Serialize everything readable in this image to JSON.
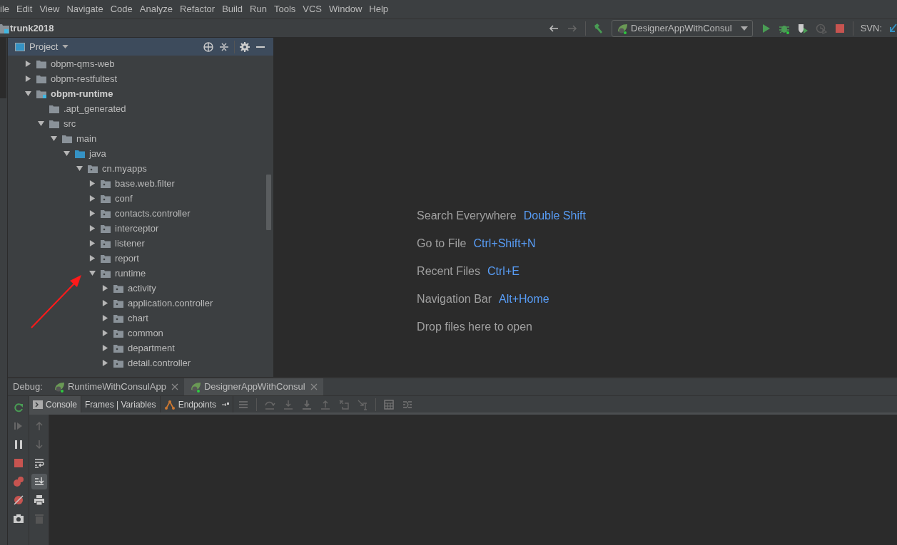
{
  "menu": [
    "ile",
    "Edit",
    "View",
    "Navigate",
    "Code",
    "Analyze",
    "Refactor",
    "Build",
    "Run",
    "Tools",
    "VCS",
    "Window",
    "Help"
  ],
  "nav": {
    "project": "trunk2018",
    "run_config": "DesignerAppWithConsul",
    "svn_label": "SVN:"
  },
  "project_panel": {
    "title": "Project",
    "tree": [
      {
        "label": "obpm-qms-web",
        "kind": "folder",
        "expanded": false
      },
      {
        "label": "obpm-restfultest",
        "kind": "folder",
        "expanded": false
      },
      {
        "label": "obpm-runtime",
        "kind": "module",
        "expanded": true,
        "children": [
          {
            "label": ".apt_generated",
            "kind": "folder"
          },
          {
            "label": "src",
            "kind": "folder",
            "expanded": true,
            "children": [
              {
                "label": "main",
                "kind": "folder",
                "expanded": true,
                "children": [
                  {
                    "label": "java",
                    "kind": "source",
                    "expanded": true,
                    "children": [
                      {
                        "label": "cn.myapps",
                        "kind": "package",
                        "expanded": true,
                        "children": [
                          {
                            "label": "base.web.filter",
                            "kind": "package",
                            "expanded": false
                          },
                          {
                            "label": "conf",
                            "kind": "package",
                            "expanded": false
                          },
                          {
                            "label": "contacts.controller",
                            "kind": "package",
                            "expanded": false
                          },
                          {
                            "label": "interceptor",
                            "kind": "package",
                            "expanded": false
                          },
                          {
                            "label": "listener",
                            "kind": "package",
                            "expanded": false
                          },
                          {
                            "label": "report",
                            "kind": "package",
                            "expanded": false
                          },
                          {
                            "label": "runtime",
                            "kind": "package",
                            "expanded": true,
                            "children": [
                              {
                                "label": "activity",
                                "kind": "package",
                                "expanded": false
                              },
                              {
                                "label": "application.controller",
                                "kind": "package",
                                "expanded": false
                              },
                              {
                                "label": "chart",
                                "kind": "package",
                                "expanded": false
                              },
                              {
                                "label": "common",
                                "kind": "package",
                                "expanded": false
                              },
                              {
                                "label": "department",
                                "kind": "package",
                                "expanded": false
                              },
                              {
                                "label": "detail.controller",
                                "kind": "package",
                                "expanded": false
                              }
                            ]
                          }
                        ]
                      }
                    ]
                  }
                ]
              }
            ]
          }
        ]
      }
    ]
  },
  "editor_hints": [
    {
      "action": "Search Everywhere",
      "shortcut": "Double Shift"
    },
    {
      "action": "Go to File",
      "shortcut": "Ctrl+Shift+N"
    },
    {
      "action": "Recent Files",
      "shortcut": "Ctrl+E"
    },
    {
      "action": "Navigation Bar",
      "shortcut": "Alt+Home"
    },
    {
      "action": "Drop files here to open"
    }
  ],
  "debug": {
    "label": "Debug:",
    "tabs": [
      {
        "label": "RuntimeWithConsulApp",
        "selected": false
      },
      {
        "label": "DesignerAppWithConsul",
        "selected": true
      }
    ],
    "subtabs": [
      {
        "label": "Console",
        "kind": "console",
        "selected": true
      },
      {
        "label": "Frames | Variables",
        "kind": "frames",
        "selected": false
      },
      {
        "label": "Endpoints",
        "kind": "endpoints",
        "selected": false
      }
    ]
  }
}
